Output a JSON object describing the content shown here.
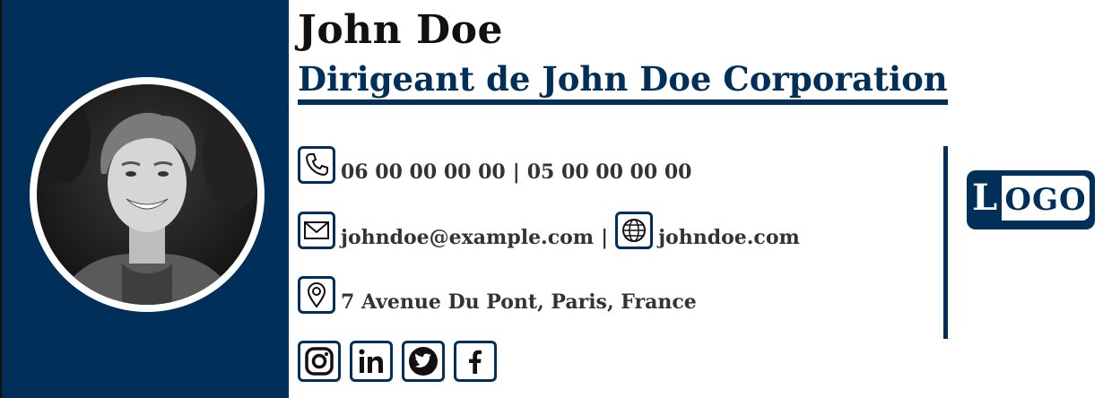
{
  "profile": {
    "name": "John Doe",
    "title": "Dirigeant de John Doe Corporation"
  },
  "contact": {
    "phone_mobile": "06 00 00 00 00",
    "phone_sep": "|",
    "phone_office": "05 00 00 00 00",
    "email": "johndoe@example.com",
    "email_sep": "|",
    "website": "johndoe.com",
    "address": "7 Avenue Du Pont, Paris, France"
  },
  "social": [
    "instagram-icon",
    "linkedin-icon",
    "twitter-icon",
    "facebook-icon"
  ],
  "logo": {
    "first_letter": "L",
    "rest": "OGO"
  },
  "colors": {
    "brand": "#002f5a",
    "text": "#333333"
  }
}
